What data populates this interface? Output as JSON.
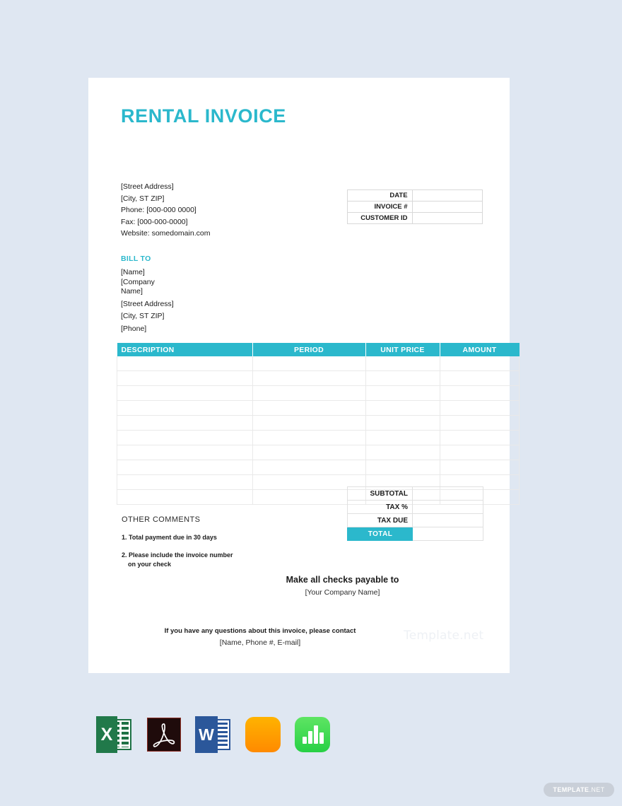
{
  "document": {
    "title": "RENTAL INVOICE",
    "accent_color": "#2bb8cc",
    "page_background": "#dfe7f2",
    "watermark": "Template.net"
  },
  "sender": {
    "street": "[Street Address]",
    "city_state_zip": "[City, ST  ZIP]",
    "phone": "Phone: [000-000 0000]",
    "fax": "Fax: [000-000-0000]",
    "website": "Website: somedomain.com"
  },
  "meta": {
    "rows": [
      {
        "label": "DATE",
        "value": ""
      },
      {
        "label": "INVOICE #",
        "value": ""
      },
      {
        "label": "CUSTOMER ID",
        "value": ""
      }
    ]
  },
  "bill_to": {
    "heading": "BILL TO",
    "name": "[Name]",
    "company_line1": "[Company",
    "company_line2": "Name]",
    "street": "[Street Address]",
    "city_state_zip": "[City, ST  ZIP]",
    "phone": "[Phone]"
  },
  "items_table": {
    "columns": [
      "DESCRIPTION",
      "PERIOD",
      "UNIT PRICE",
      "AMOUNT"
    ],
    "row_count": 10,
    "rows": [
      [
        "",
        "",
        "",
        ""
      ],
      [
        "",
        "",
        "",
        ""
      ],
      [
        "",
        "",
        "",
        ""
      ],
      [
        "",
        "",
        "",
        ""
      ],
      [
        "",
        "",
        "",
        ""
      ],
      [
        "",
        "",
        "",
        ""
      ],
      [
        "",
        "",
        "",
        ""
      ],
      [
        "",
        "",
        "",
        ""
      ],
      [
        "",
        "",
        "",
        ""
      ],
      [
        "",
        "",
        "",
        ""
      ]
    ]
  },
  "totals": {
    "rows": [
      {
        "label": "SUBTOTAL",
        "value": ""
      },
      {
        "label": "TAX %",
        "value": ""
      },
      {
        "label": "TAX DUE",
        "value": ""
      },
      {
        "label": "TOTAL",
        "value": "",
        "highlighted": true
      }
    ]
  },
  "comments": {
    "heading": "OTHER  COMMENTS",
    "item1": "1. Total payment due in 30 days",
    "item2_line1": "2. Please include the invoice number",
    "item2_line2": "on your check"
  },
  "payable": {
    "line1": "Make all checks payable to",
    "line2": "[Your Company Name]"
  },
  "contact": {
    "line1": "If you have any questions about this invoice, please contact",
    "line2": "[Name,   Phone #,   E-mail]"
  },
  "format_icons": [
    {
      "name": "excel-icon",
      "label": "X"
    },
    {
      "name": "pdf-icon",
      "label": ""
    },
    {
      "name": "word-icon",
      "label": "W"
    },
    {
      "name": "apple-pages-icon",
      "label": ""
    },
    {
      "name": "apple-numbers-icon",
      "label": ""
    }
  ],
  "badge": {
    "bold_part": "TEMPLATE",
    "light_part": ".NET"
  }
}
